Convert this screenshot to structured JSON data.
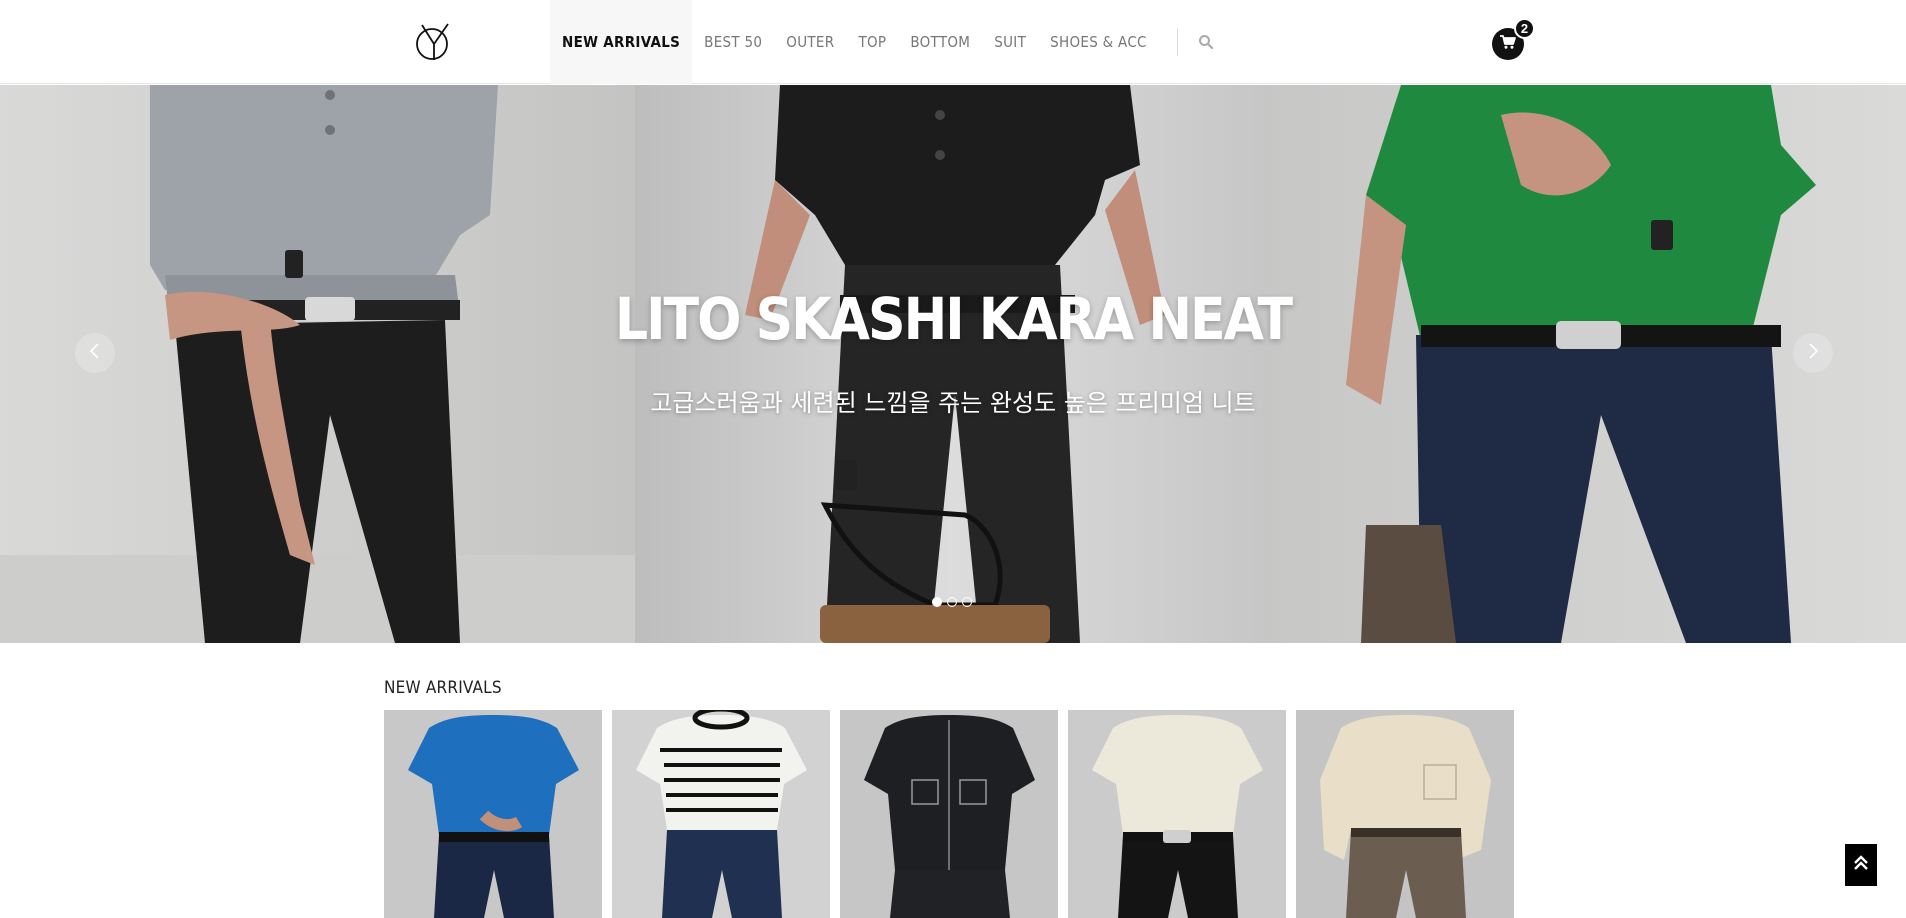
{
  "header": {
    "logo_label": "Y logo",
    "nav": [
      {
        "label": "NEW ARRIVALS",
        "active": true
      },
      {
        "label": "BEST 50"
      },
      {
        "label": "OUTER"
      },
      {
        "label": "TOP"
      },
      {
        "label": "BOTTOM"
      },
      {
        "label": "SUIT"
      },
      {
        "label": "SHOES & ACC"
      }
    ],
    "search_icon": "search-icon",
    "cart_icon": "cart-icon",
    "cart_count": "2"
  },
  "hero": {
    "title": "LITO SKASHI KARA NEAT",
    "subtitle": "고급스러움과 세련된 느낌을 주는 완성도 높은 프리미엄 니트",
    "prev_icon": "chevron-left-icon",
    "next_icon": "chevron-right-icon",
    "slides": 3,
    "active_slide": 1,
    "panel_colors": [
      "#9ea3a9",
      "#1c1c1c",
      "#1f8a3f"
    ]
  },
  "section": {
    "title": "NEW ARRIVALS",
    "products": [
      {
        "shirt_color": "#1f6fbf",
        "pants_color": "#1a2845"
      },
      {
        "shirt_color": "#f2f2ee",
        "pants_color": "#203050"
      },
      {
        "shirt_color": "#1e1f23",
        "pants_color": "#202226"
      },
      {
        "shirt_color": "#ece8da",
        "pants_color": "#141414"
      },
      {
        "shirt_color": "#e9dfc8",
        "pants_color": "#6b5d50"
      }
    ]
  },
  "scroll_top_icon": "double-chevron-up-icon"
}
